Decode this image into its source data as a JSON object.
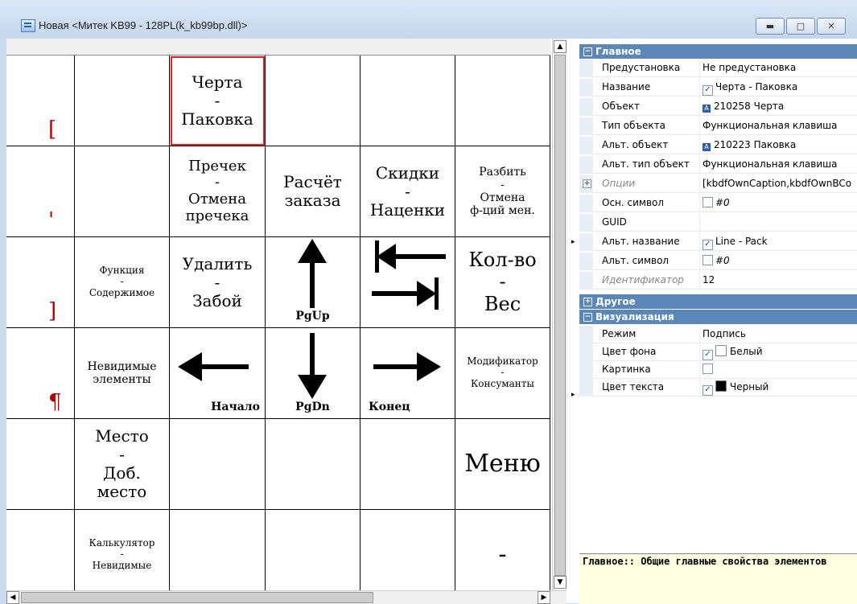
{
  "window": {
    "title": "Новая <Митек KB99 - 128PL(k_kb99bp.dll)>"
  },
  "keyboard": {
    "rows": [
      {
        "label": "[",
        "cells": [
          "",
          "Черта|-|Паковка",
          "",
          "",
          ""
        ]
      },
      {
        "label": "'",
        "cells": [
          "",
          "Пречек|-|Отмена|пречека",
          "Расчёт|заказа",
          "Скидки|-|Наценки",
          "Разбить|-|Отмена|ф-ций мен."
        ]
      },
      {
        "label": "]",
        "cells": [
          "Функция|-|Содержимое",
          "Удалить|-|Забой",
          "PgUp",
          "",
          "Кол-во|-|Вес"
        ]
      },
      {
        "label": "¶",
        "cells": [
          "Невидимые|элементы",
          "Начало",
          "PgDn",
          "Конец",
          "Модификатор|-|Консуманты"
        ]
      },
      {
        "label": "",
        "cells": [
          "Место|-|Доб.|место",
          "",
          "",
          "",
          "Меню"
        ]
      },
      {
        "label": "",
        "cells": [
          "Калькулятор|-|Невидимые",
          "",
          "",
          "",
          "-"
        ]
      }
    ],
    "selected_cell": "Черта - Паковка"
  },
  "properties": {
    "sections": {
      "main": "Главное",
      "other": "Другое",
      "visual": "Визуализация"
    },
    "main_rows": [
      {
        "name": "Предустановка",
        "value": "Не предустановка"
      },
      {
        "name": "Название",
        "value": "Черта   - Паковка",
        "checked": true
      },
      {
        "name": "Объект",
        "value": "210258 Черта",
        "icon": "object-icon"
      },
      {
        "name": "Тип объекта",
        "value": "Функциональная клавиша"
      },
      {
        "name": "Альт. объект",
        "value": "210223 Паковка",
        "icon": "object-icon"
      },
      {
        "name": "Альт. тип объект",
        "value": "Функциональная клавиша"
      },
      {
        "name": "Опции",
        "value": "[kbdfOwnCaption,kbdfOwnBCo",
        "expandable": true,
        "italic": true
      },
      {
        "name": "Осн. символ",
        "value": "#0",
        "checked": false
      },
      {
        "name": "GUID",
        "value": ""
      },
      {
        "name": "Альт. название",
        "value": "Line - Pack",
        "checked": true
      },
      {
        "name": "Альт. символ",
        "value": "#0",
        "checked": false
      },
      {
        "name": "Идентификатор",
        "value": "12",
        "italic": true
      }
    ],
    "visual_rows": [
      {
        "name": "Режим",
        "value": "Подпись"
      },
      {
        "name": "Цвет фона",
        "value": "Белый",
        "checked": true,
        "swatch": "#ffffff"
      },
      {
        "name": "Картинка",
        "value": "",
        "checked": false
      },
      {
        "name": "Цвет текста",
        "value": "Черный",
        "checked": true,
        "swatch": "#000000"
      }
    ],
    "description": "Главное:: Общие главные свойства элементов"
  },
  "colors": {
    "accent": "#5a86b8",
    "selection": "#e02020",
    "desc_bg": "#ffffe1"
  }
}
